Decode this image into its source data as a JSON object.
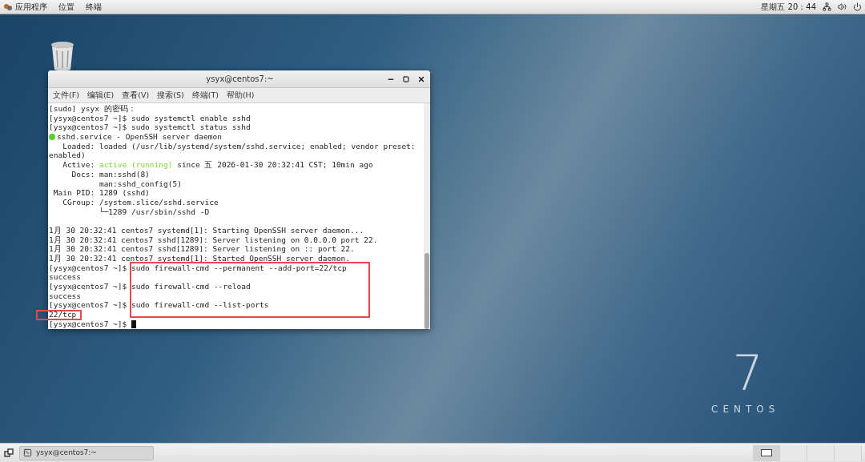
{
  "top_bar": {
    "menus": [
      {
        "label": "应用程序",
        "kind": "apps"
      },
      {
        "label": "位置",
        "kind": "plain"
      },
      {
        "label": "终端",
        "kind": "plain"
      }
    ],
    "clock": "星期五 20：44"
  },
  "terminal": {
    "title": "ysyx@centos7:~",
    "menu": [
      "文件(F)",
      "编辑(E)",
      "查看(V)",
      "搜索(S)",
      "终端(T)",
      "帮助(H)"
    ],
    "lines": [
      {
        "text": "[sudo] ysyx 的密码："
      },
      {
        "text": "[ysyx@centos7 ~]$ sudo systemctl enable sshd"
      },
      {
        "text": "[ysyx@centos7 ~]$ sudo systemctl status sshd"
      },
      {
        "kind": "status",
        "color": "#5bd12f",
        "text": "sshd.service - OpenSSH server daemon"
      },
      {
        "text": "   Loaded: loaded (/usr/lib/systemd/system/sshd.service; enabled; vendor preset:"
      },
      {
        "text": "enabled)"
      },
      {
        "segments": [
          {
            "text": "   Active: ",
            "kind": "plain"
          },
          {
            "text": "active (running)",
            "kind": "ok"
          },
          {
            "text": " since 五 2026-01-30 20:32:41 CST; 10min ago",
            "kind": "plain"
          }
        ]
      },
      {
        "text": "     Docs: man:sshd(8)"
      },
      {
        "text": "           man:sshd_config(5)"
      },
      {
        "text": " Main PID: 1289 (sshd)"
      },
      {
        "text": "   CGroup: /system.slice/sshd.service"
      },
      {
        "text": "           └─1289 /usr/sbin/sshd -D"
      },
      {
        "kind": "blank"
      },
      {
        "text": "1月 30 20:32:41 centos7 systemd[1]: Starting OpenSSH server daemon..."
      },
      {
        "text": "1月 30 20:32:41 centos7 sshd[1289]: Server listening on 0.0.0.0 port 22."
      },
      {
        "text": "1月 30 20:32:41 centos7 sshd[1289]: Server listening on :: port 22."
      },
      {
        "text": "1月 30 20:32:41 centos7 systemd[1]: Started OpenSSH server daemon."
      },
      {
        "text": "[ysyx@centos7 ~]$ sudo firewall-cmd --permanent --add-port=22/tcp"
      },
      {
        "text": "success"
      },
      {
        "text": "[ysyx@centos7 ~]$ sudo firewall-cmd --reload"
      },
      {
        "text": "success"
      },
      {
        "text": "[ysyx@centos7 ~]$ sudo firewall-cmd --list-ports"
      },
      {
        "text": "22/tcp"
      },
      {
        "kind": "prompt",
        "text": "[ysyx@centos7 ~]$ "
      }
    ],
    "annotations": {
      "commands_box": true,
      "output_box": true
    }
  },
  "logo": {
    "number": "7",
    "name": "CENTOS"
  },
  "taskbar": {
    "tasks": [
      {
        "label": "ysyx@centos7:~"
      }
    ],
    "workspaces": [
      {
        "selected": true
      },
      {
        "selected": false
      },
      {
        "selected": false
      },
      {
        "selected": false
      }
    ]
  }
}
